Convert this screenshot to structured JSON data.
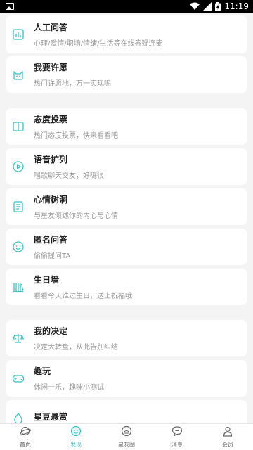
{
  "status_bar": {
    "time": "11:19"
  },
  "cards": [
    {
      "title": "人工问答",
      "subtitle": "心理/爱情/职场/情绪/生活等在线答疑连麦",
      "icon": "chart-icon"
    },
    {
      "title": "我要许愿",
      "subtitle": "热门许愿地，万一实现呢",
      "icon": "cat-face-icon"
    },
    {
      "title": "态度投票",
      "subtitle": "热门态度投票，快来看看吧",
      "icon": "book-icon"
    },
    {
      "title": "语音扩列",
      "subtitle": "唱歌聊天交友，好嗨很",
      "icon": "play-icon"
    },
    {
      "title": "心情树洞",
      "subtitle": "与星友倾述你的内心与心情",
      "icon": "notebook-icon"
    },
    {
      "title": "匿名问答",
      "subtitle": "偷偷提问TA",
      "icon": "smiley-icon"
    },
    {
      "title": "生日墙",
      "subtitle": "看看今天谁过生日，送上祝福哦",
      "icon": "books-icon"
    },
    {
      "title": "我的决定",
      "subtitle": "决定大转盘，从此告别纠结",
      "icon": "scale-icon"
    },
    {
      "title": "趣玩",
      "subtitle": "休闲一乐，趣味小测试",
      "icon": "gamepad-icon"
    },
    {
      "title": "星豆悬赏",
      "subtitle": "",
      "icon": "drop-icon"
    }
  ],
  "tabs": [
    {
      "label": "首页",
      "icon": "planet-icon"
    },
    {
      "label": "发现",
      "icon": "discover-icon"
    },
    {
      "label": "星友圈",
      "icon": "friends-icon"
    },
    {
      "label": "消息",
      "icon": "chat-icon"
    },
    {
      "label": "会员",
      "icon": "user-icon"
    }
  ],
  "active_tab": "发现",
  "accent_color": "#39c3c3"
}
